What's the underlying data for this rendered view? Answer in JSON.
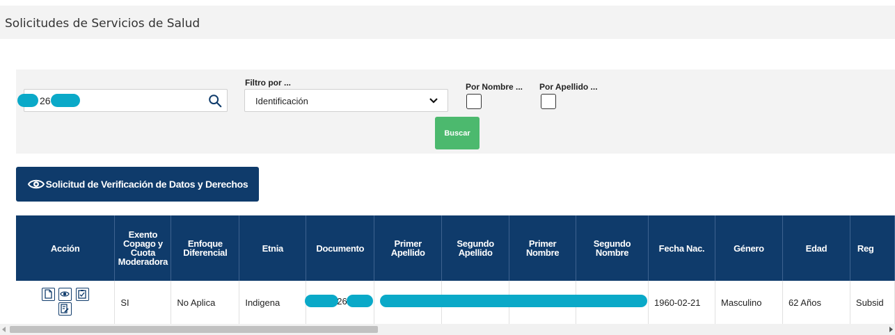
{
  "page": {
    "title": "Solicitudes de Servicios de Salud"
  },
  "filters": {
    "search_value": "26",
    "filter_label": "Filtro por ...",
    "filter_selected": "Identificación",
    "by_name_label": "Por Nombre ...",
    "by_surname_label": "Por Apellido ...",
    "search_button": "Buscar"
  },
  "verification_button": {
    "label": "Solicitud de Verificación de Datos y Derechos",
    "icon": "eye-icon"
  },
  "table": {
    "headers": {
      "accion": "Acción",
      "exento": "Exento Copago y Cuota Moderadora",
      "enfoque": "Enfoque Diferencial",
      "etnia": "Etnia",
      "documento": "Documento",
      "primer_apellido": "Primer Apellido",
      "segundo_apellido": "Segundo Apellido",
      "primer_nombre": "Primer Nombre",
      "segundo_nombre": "Segundo Nombre",
      "fecha_nac": "Fecha Nac.",
      "genero": "Género",
      "edad": "Edad",
      "regimen": "Reg"
    },
    "rows": [
      {
        "exento": "SI",
        "enfoque": "No Aplica",
        "etnia": "Indigena",
        "documento": "26",
        "fecha_nac": "1960-02-21",
        "genero": "Masculino",
        "edad": "62 Años",
        "regimen": "Subsid"
      }
    ]
  },
  "colors": {
    "primary": "#0f3b6b",
    "success": "#4cb96e",
    "redaction": "#0aa9c8"
  }
}
